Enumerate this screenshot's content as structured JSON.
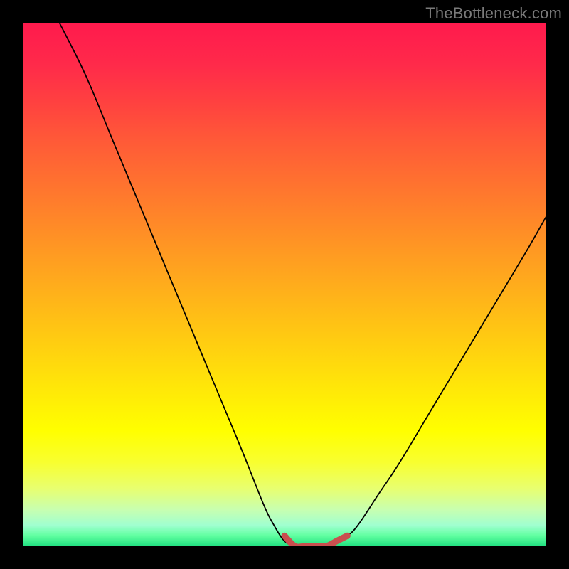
{
  "watermark": "TheBottleneck.com",
  "chart_data": {
    "type": "line",
    "title": "",
    "xlabel": "",
    "ylabel": "",
    "xlim": [
      0,
      100
    ],
    "ylim": [
      0,
      100
    ],
    "grid": false,
    "series": [
      {
        "name": "bottleneck-curve",
        "color": "#000000",
        "x": [
          7,
          12,
          17,
          22,
          27,
          32,
          37,
          42,
          46,
          48,
          50,
          52,
          54,
          56,
          58,
          60,
          62,
          64,
          68,
          72,
          78,
          84,
          90,
          96,
          100
        ],
        "values": [
          100,
          90,
          78,
          66,
          54,
          42,
          30,
          18,
          8,
          4,
          1,
          0,
          0,
          0,
          0,
          1,
          2,
          4,
          10,
          16,
          26,
          36,
          46,
          56,
          63
        ]
      },
      {
        "name": "optimal-range-marker",
        "color": "#c94f4f",
        "x": [
          50,
          52,
          54,
          56,
          58,
          60,
          62
        ],
        "values": [
          2,
          0,
          0,
          0,
          0,
          1,
          2
        ]
      }
    ],
    "background_gradient": {
      "top": "#ff1a4d",
      "mid": "#ffff00",
      "bottom": "#20e080"
    }
  }
}
